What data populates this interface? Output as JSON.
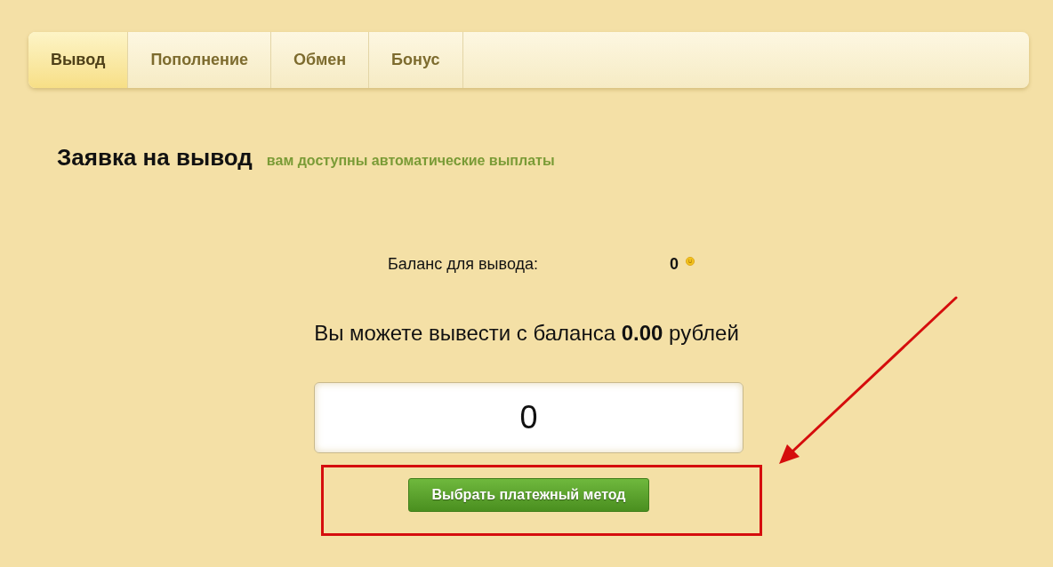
{
  "tabs": [
    {
      "label": "Вывод",
      "selected": true
    },
    {
      "label": "Пополнение",
      "selected": false
    },
    {
      "label": "Обмен",
      "selected": false
    },
    {
      "label": "Бонус",
      "selected": false
    }
  ],
  "heading": {
    "title": "Заявка на вывод",
    "note": "вам доступны автоматические выплаты"
  },
  "balance": {
    "label": "Баланс для вывода:",
    "value": "0"
  },
  "message": "Вы можете вывести с баланса **0.00** рублей",
  "amount_field": {
    "value": "0"
  },
  "submit_button": {
    "label": "Выбрать платежный метод",
    "highlighted": true
  }
}
